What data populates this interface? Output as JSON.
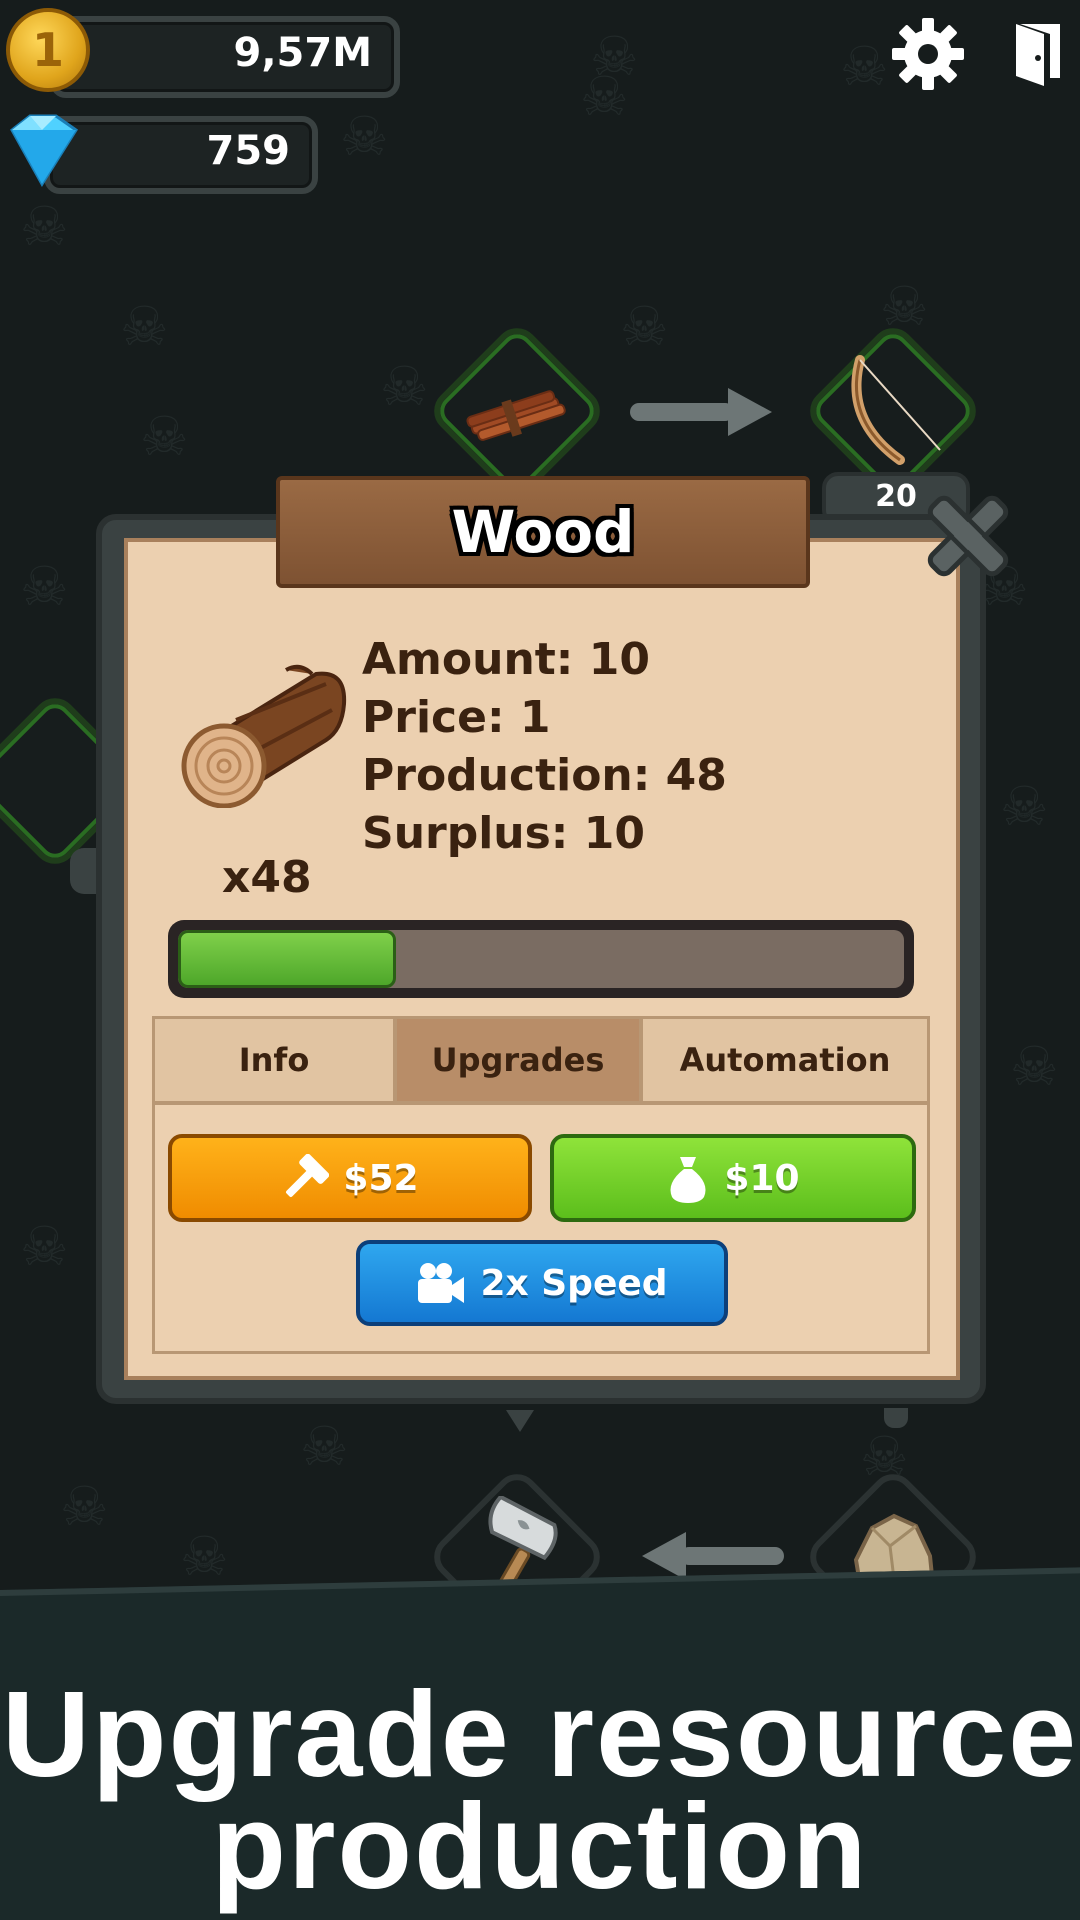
{
  "currency": {
    "coins": "9,57M",
    "coin_symbol": "1",
    "gems": "759"
  },
  "popup": {
    "title": "Wood",
    "stats": {
      "amount": "Amount: 10",
      "price": "Price: 1",
      "production": "Production: 48",
      "surplus": "Surplus: 10"
    },
    "multiplier": "x48",
    "progress": 0.3,
    "tabs": [
      {
        "label": "Info",
        "selected": false
      },
      {
        "label": "Upgrades",
        "selected": true
      },
      {
        "label": "Automation",
        "selected": false
      }
    ],
    "upgrade_button_label": "$52",
    "sell_button_label": "$10",
    "speed_button_label": "2x Speed"
  },
  "map": {
    "bow_count": "20"
  },
  "caption": {
    "line1": "Upgrade resource",
    "line2": "production"
  },
  "colors": {
    "accent_orange": "#f7a50c",
    "accent_green": "#6fd12a",
    "accent_blue": "#1f8fe0",
    "panel": "#ecd0b0",
    "background": "#161c1c"
  },
  "icons": [
    "coin-icon",
    "gem-icon",
    "gear-icon",
    "exit-door-icon",
    "sticks-icon",
    "bow-icon",
    "hammer-icon",
    "rock-icon",
    "log-icon",
    "close-icon",
    "money-bag-icon",
    "video-camera-icon"
  ]
}
